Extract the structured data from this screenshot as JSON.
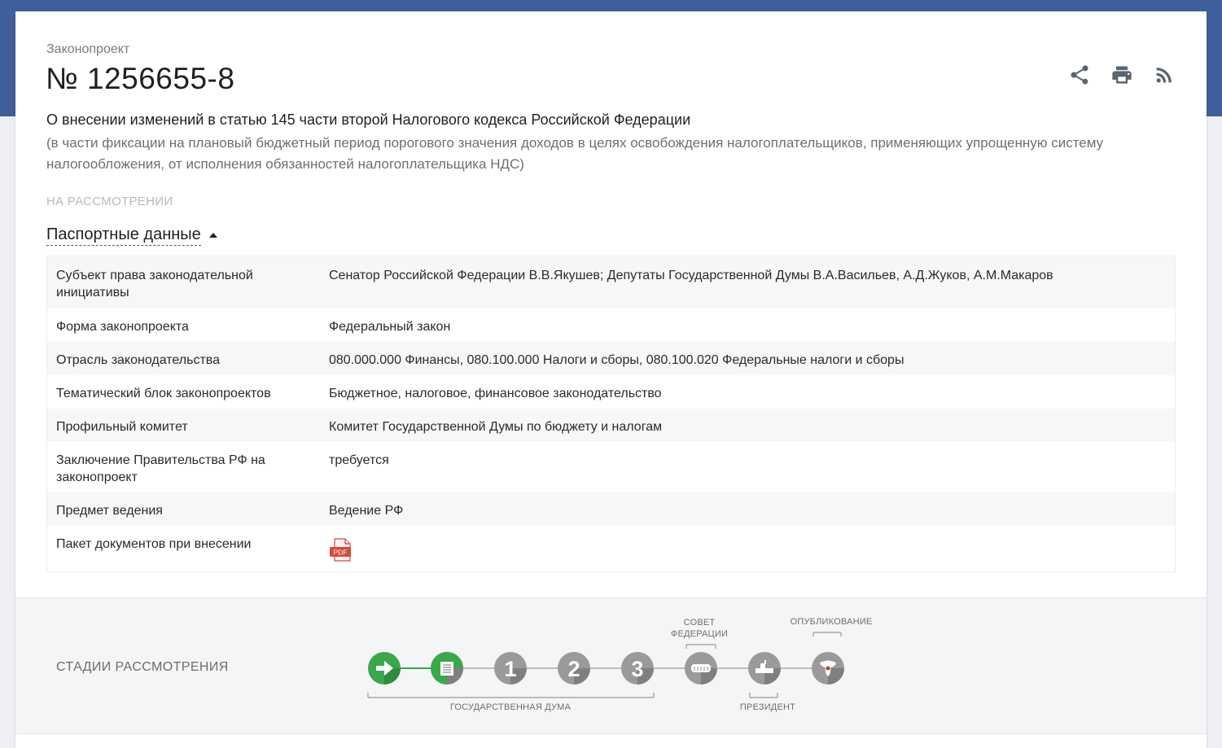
{
  "header": {
    "doc_type": "Законопроект",
    "number": "№ 1256655-8",
    "title": "О внесении изменений в статью 145 части второй Налогового кодекса Российской Федерации",
    "subtitle": "(в части фиксации на плановый бюджетный период порогового значения доходов в целях освобождения налогоплательщиков, применяющих упрощенную систему налогообложения, от исполнения обязанностей налогоплательщика НДС)",
    "status": "НА РАССМОТРЕНИИ",
    "actions": [
      {
        "icon": "share-icon"
      },
      {
        "icon": "print-icon"
      },
      {
        "icon": "rss-icon"
      }
    ]
  },
  "passport": {
    "toggle_label": "Паспортные данные",
    "rows": [
      {
        "key": "Субъект права законодательной инициативы",
        "value": "Сенатор Российской Федерации В.В.Якушев; Депутаты Государственной Думы В.А.Васильев, А.Д.Жуков, А.М.Макаров"
      },
      {
        "key": "Форма законопроекта",
        "value": "Федеральный закон"
      },
      {
        "key": "Отрасль законодательства",
        "value": "080.000.000 Финансы, 080.100.000 Налоги и сборы, 080.100.020 Федеральные налоги и сборы"
      },
      {
        "key": "Тематический блок законопроектов",
        "value": "Бюджетное, налоговое, финансовое законодательство"
      },
      {
        "key": "Профильный комитет",
        "value": "Комитет Государственной Думы по бюджету и налогам"
      },
      {
        "key": "Заключение Правительства РФ на законопроект",
        "value": "требуется"
      },
      {
        "key": "Предмет ведения",
        "value": "Ведение РФ"
      },
      {
        "key": "Пакет документов при внесении",
        "value": "",
        "attachment": {
          "icon": "pdf-icon",
          "label": "PDF"
        }
      }
    ]
  },
  "stages": {
    "title": "СТАДИИ РАССМОТРЕНИЯ",
    "labels": {
      "duma": "ГОСУДАРСТВЕННАЯ ДУМА",
      "council": "СОВЕТ ФЕДЕРАЦИИ",
      "president": "ПРЕЗИДЕНТ",
      "published": "ОПУБЛИКОВАНИЕ"
    },
    "steps": [
      {
        "id": "introduction",
        "icon": "arrow-right-icon",
        "state": "done"
      },
      {
        "id": "preliminary",
        "icon": "document-icon",
        "state": "current"
      },
      {
        "id": "reading-1",
        "text": "1",
        "state": "pending"
      },
      {
        "id": "reading-2",
        "text": "2",
        "state": "pending"
      },
      {
        "id": "reading-3",
        "text": "3",
        "state": "pending"
      },
      {
        "id": "federation-council",
        "icon": "council-icon",
        "state": "pending"
      },
      {
        "id": "president",
        "icon": "president-icon",
        "state": "pending"
      },
      {
        "id": "publication",
        "icon": "emblem-icon",
        "state": "pending"
      }
    ],
    "colors": {
      "done": "#3aa84a",
      "pending": "#9a9a9a",
      "line": "#bdbdbd"
    }
  }
}
